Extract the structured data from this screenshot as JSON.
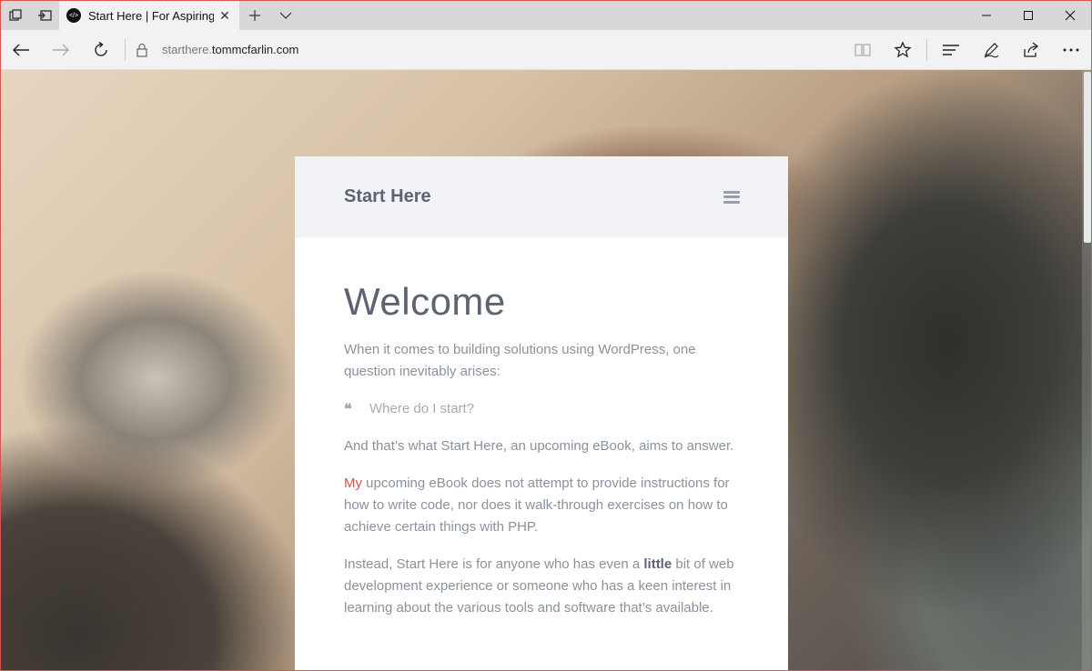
{
  "browser": {
    "tab": {
      "title": "Start Here | For Aspiring"
    },
    "address": {
      "subdomain": "starthere.",
      "domain": "tommcfarlin.com"
    }
  },
  "page": {
    "site_title": "Start Here",
    "heading": "Welcome",
    "intro": "When it comes to building solutions using WordPress, one question inevitably arises:",
    "quote": "Where do I start?",
    "para1": "And that’s what Start Here, an upcoming eBook, aims to answer.",
    "para2": {
      "highlight": "My",
      "rest": " upcoming eBook does not attempt to provide instructions for how to write code, nor does it walk-through exercises on how to achieve certain things with PHP."
    },
    "para3": {
      "before": "Instead, Start Here is for anyone who has even a ",
      "bold": "little",
      "after": " bit of web development experience or someone who has a keen interest in learning about the various tools and software that’s available."
    }
  },
  "colors": {
    "accent": "#d9534f",
    "title": "#5b6470",
    "body_text": "#8a929c",
    "header_bg": "#f2f3f6"
  }
}
